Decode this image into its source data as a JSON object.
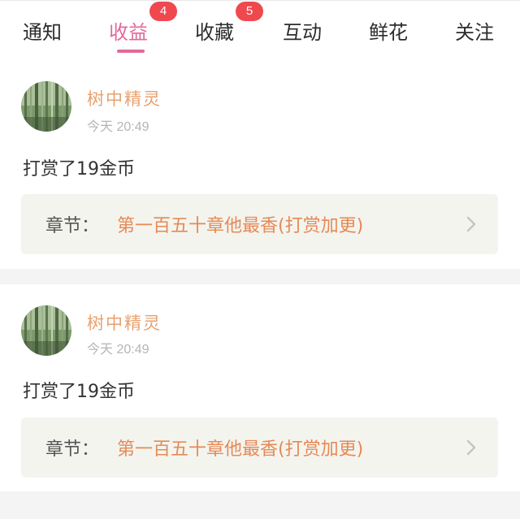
{
  "tabs": [
    {
      "label": "通知",
      "active": false,
      "badge": ""
    },
    {
      "label": "收益",
      "active": true,
      "badge": "4"
    },
    {
      "label": "收藏",
      "active": false,
      "badge": "5"
    },
    {
      "label": "互动",
      "active": false,
      "badge": ""
    },
    {
      "label": "鲜花",
      "active": false,
      "badge": ""
    },
    {
      "label": "关注",
      "active": false,
      "badge": ""
    }
  ],
  "notifications": [
    {
      "user": "树中精灵",
      "time": "今天 20:49",
      "message": "打赏了19金币",
      "chapter_label": "章节：",
      "chapter_title": "第一百五十章他最香(打赏加更)"
    },
    {
      "user": "树中精灵",
      "time": "今天 20:49",
      "message": "打赏了19金币",
      "chapter_label": "章节：",
      "chapter_title": "第一百五十章他最香(打赏加更)"
    }
  ],
  "colors": {
    "accent": "#e2699a",
    "badge": "#f0484f",
    "username": "#e8a06e",
    "chapter_title": "#e58a57"
  },
  "icons": {
    "chapter_arrow": "chevron-right-icon",
    "avatar": "bamboo-forest-avatar"
  }
}
